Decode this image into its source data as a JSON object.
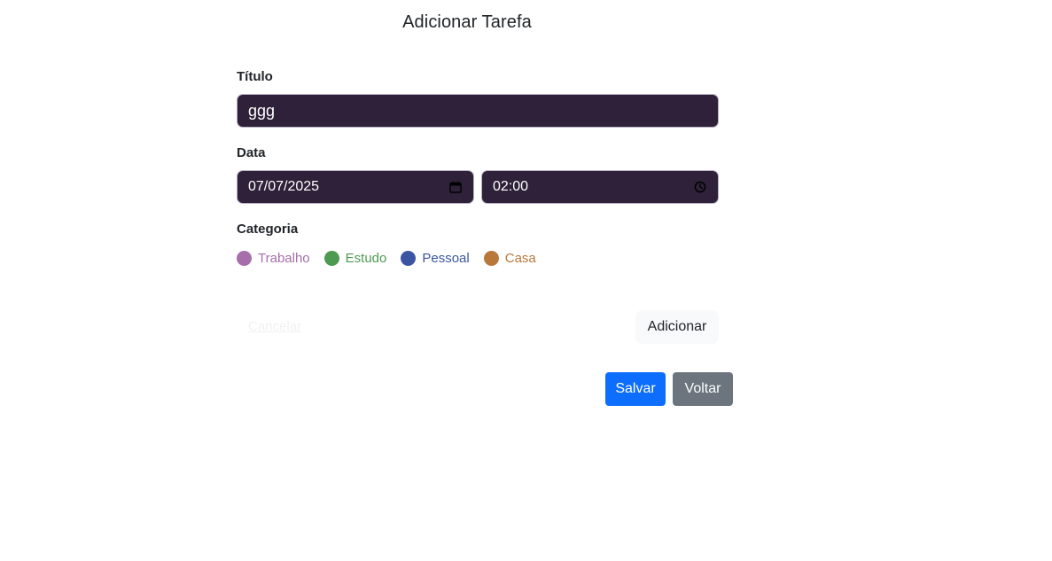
{
  "page": {
    "title": "Adicionar Tarefa"
  },
  "form": {
    "title_label": "Título",
    "title_value": "ggg",
    "date_label": "Data",
    "date_value": "07/07/2025",
    "time_value": "02:00",
    "category_label": "Categoria",
    "categories": [
      {
        "label": "Trabalho",
        "color": "#a66eab"
      },
      {
        "label": "Estudo",
        "color": "#4d9a53"
      },
      {
        "label": "Pessoal",
        "color": "#3b55a2"
      },
      {
        "label": "Casa",
        "color": "#b8783a"
      }
    ]
  },
  "actions": {
    "cancel_label": "Cancelar",
    "add_label": "Adicionar",
    "save_label": "Salvar",
    "back_label": "Voltar"
  },
  "colors": {
    "input_background": "#2e2139",
    "primary": "#0d6efd",
    "secondary": "#6c757d"
  },
  "icons": {
    "date_picker": "calendar-icon",
    "time_picker": "clock-icon"
  }
}
